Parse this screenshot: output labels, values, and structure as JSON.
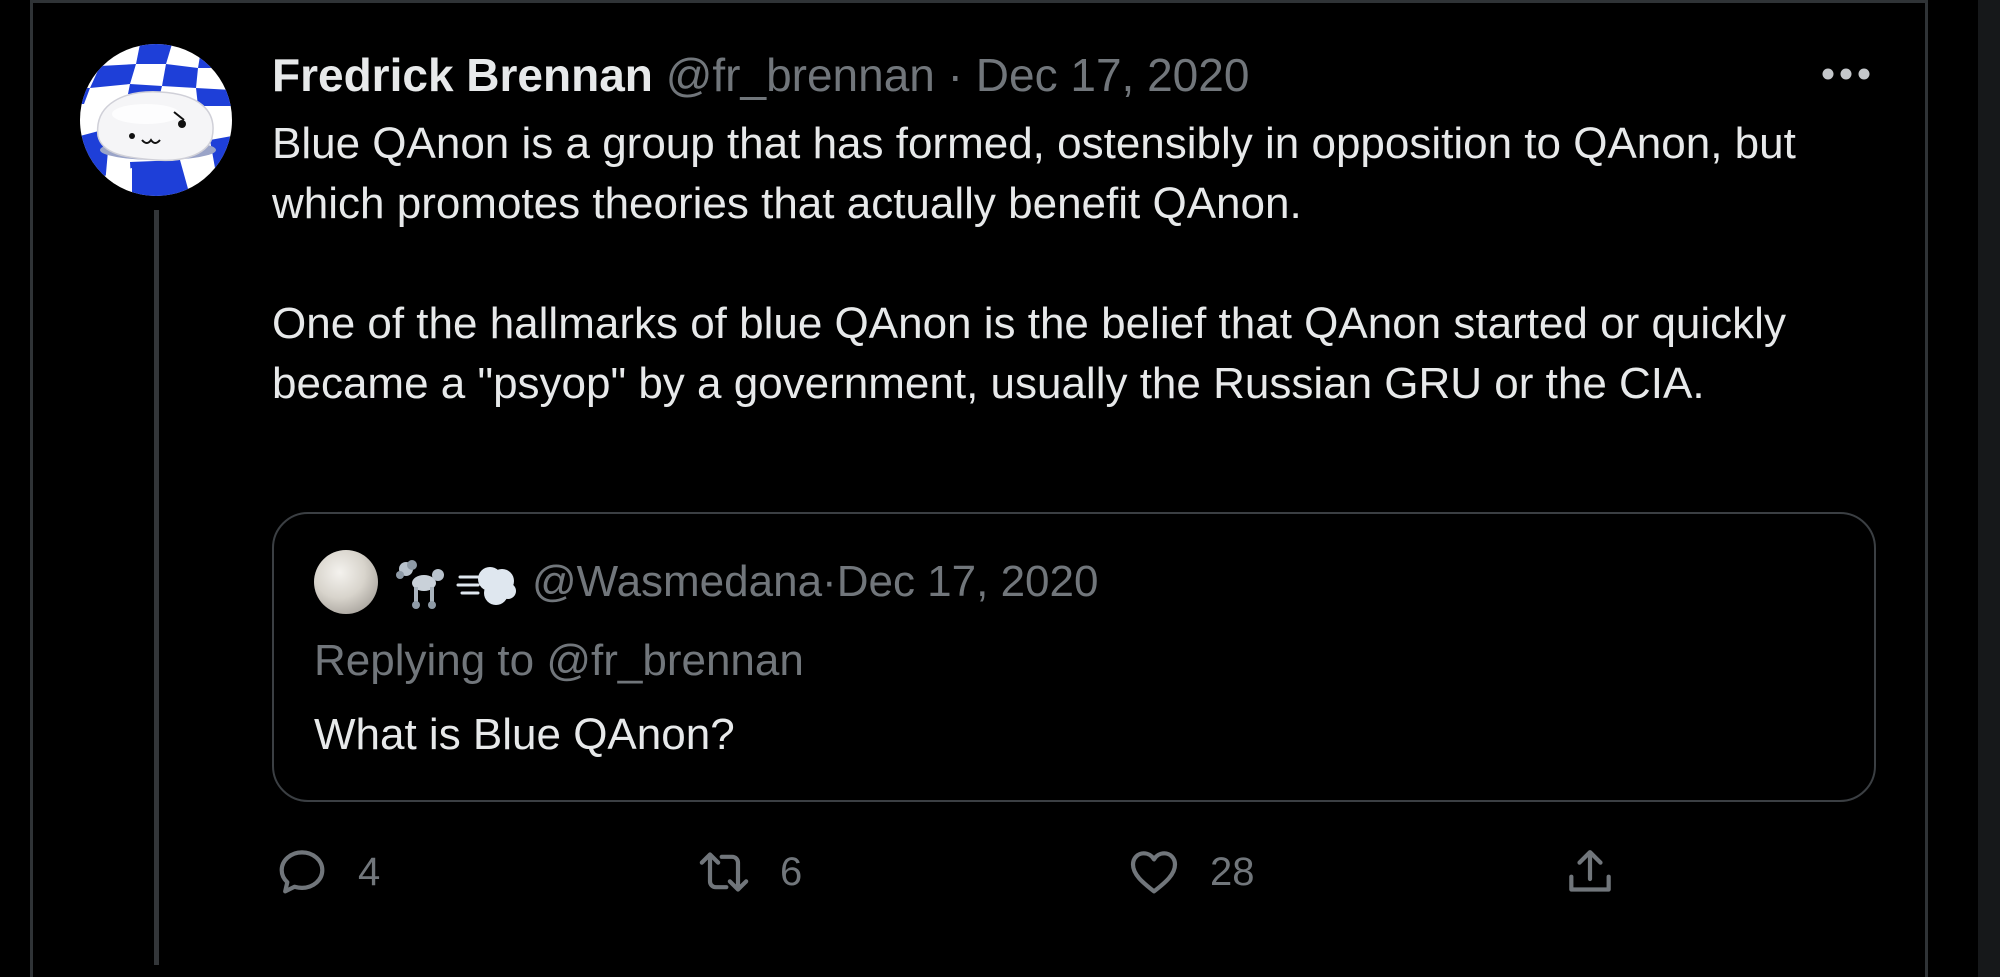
{
  "tweet": {
    "author_name": "Fredrick Brennan",
    "author_handle": "@fr_brennan",
    "separator": "·",
    "date": "Dec 17, 2020",
    "more_icon": "more-horizontal-icon",
    "paragraph_1": "Blue QAnon is a group that has formed, ostensibly in opposition to QAnon, but which promotes theories that actually benefit QAnon.",
    "paragraph_2": "One of the hallmarks of blue QAnon is the belief that QAnon started or quickly became a \"psyop\" by a government, usually the Russian GRU or the CIA."
  },
  "quote": {
    "emoji_icons": [
      "poodle-emoji-icon",
      "dash-emoji-icon"
    ],
    "handle": "@Wasmedana",
    "separator": "·",
    "date": "Dec 17, 2020",
    "replying_to": "Replying to @fr_brennan",
    "text": "What is Blue QAnon?"
  },
  "actions": {
    "reply": {
      "icon": "reply-icon",
      "count": "4"
    },
    "retweet": {
      "icon": "retweet-icon",
      "count": "6"
    },
    "like": {
      "icon": "heart-icon",
      "count": "28"
    },
    "share": {
      "icon": "share-icon"
    }
  },
  "colors": {
    "background": "#000000",
    "primary_text": "#e7e9ea",
    "secondary_text": "#71767b",
    "border": "#2f3336",
    "avatar_blue": "#1e3fd8"
  }
}
